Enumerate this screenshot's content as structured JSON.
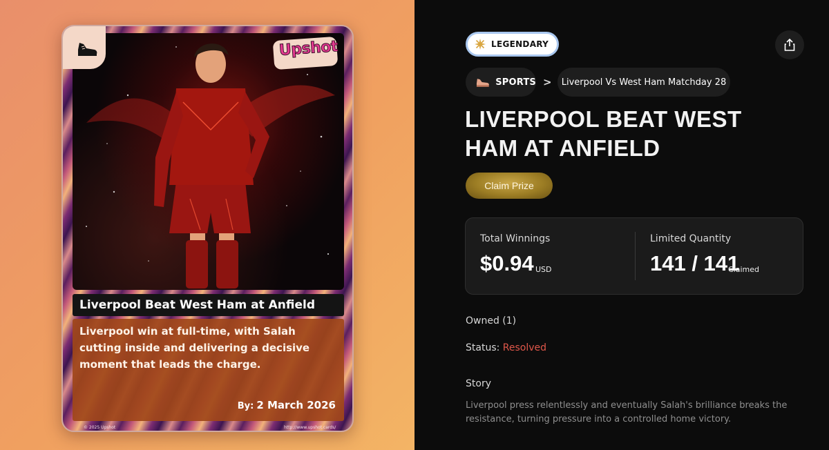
{
  "card": {
    "logo": "Upshot",
    "title": "Liverpool Beat West Ham at Anfield",
    "description": "Liverpool win at full-time, with Salah cutting inside and delivering a decisive moment that leads the charge.",
    "by_label": "By:",
    "date": "2 March 2026",
    "copyright": "© 2025 Upshot",
    "url": "http://www.upshot.cards/"
  },
  "rarity": {
    "label": "LEGENDARY",
    "icon": "star-icon"
  },
  "breadcrumb": {
    "category": "SPORTS",
    "category_icon": "sneaker-icon",
    "separator": ">",
    "event": "Liverpool Vs West Ham Matchday 28"
  },
  "title": "LIVERPOOL BEAT WEST HAM AT ANFIELD",
  "claim_button": "Claim Prize",
  "stats": {
    "winnings_label": "Total Winnings",
    "winnings_value": "$0.94",
    "winnings_unit": "USD",
    "quantity_label": "Limited Quantity",
    "quantity_value": "141 / 141",
    "quantity_unit": "Claimed"
  },
  "owned": "Owned (1)",
  "status": {
    "label": "Status:",
    "value": "Resolved"
  },
  "story": {
    "heading": "Story",
    "text": "Liverpool press relentlessly and eventually Salah's brilliance breaks the resistance, turning pressure into a controlled home victory."
  },
  "colors": {
    "accent_gold": "#a8862c",
    "status_resolved": "#e0574a",
    "logo_pink": "#e63a92"
  }
}
